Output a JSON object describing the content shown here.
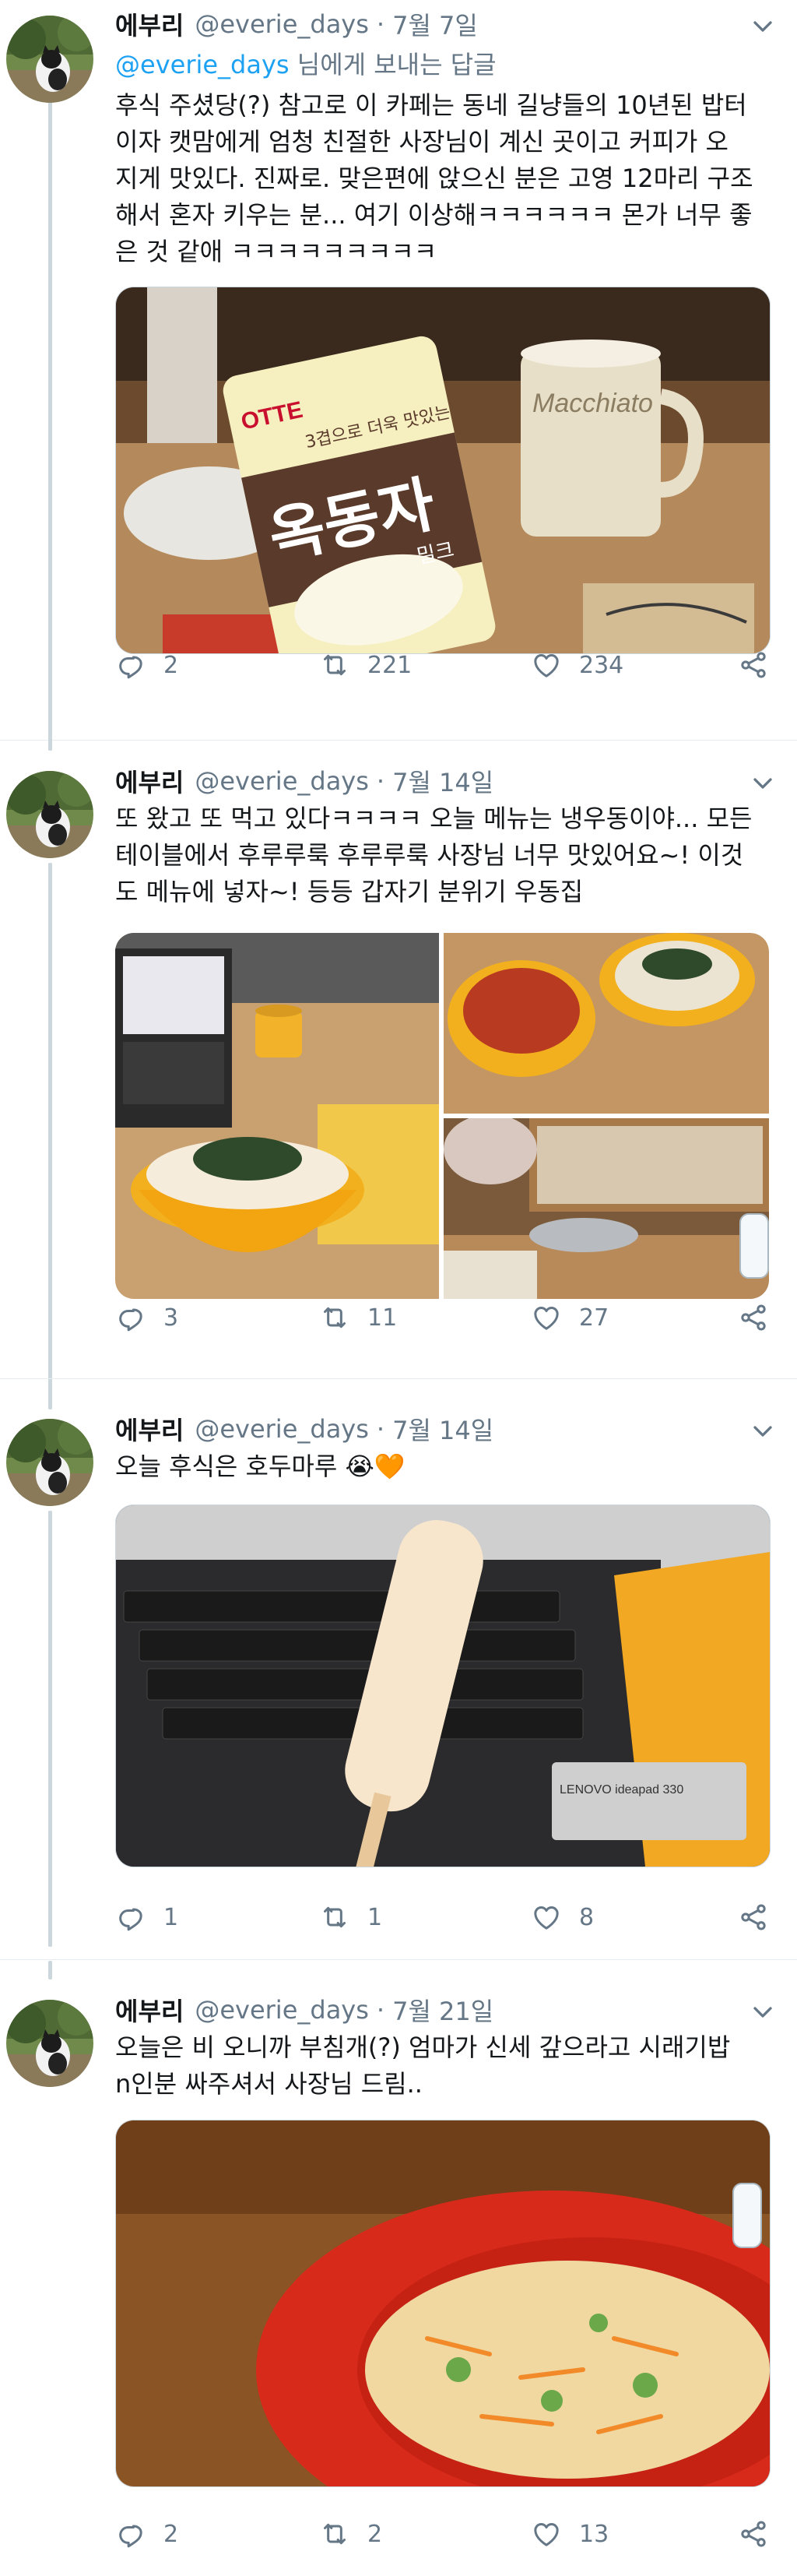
{
  "tweets": [
    {
      "name": "에부리",
      "handle": "@everie_days",
      "dot": "·",
      "date": "7월 7일",
      "reply_mention": "@everie_days",
      "reply_rest": " 님에게 보내는 답글",
      "lines": [
        "후식 주셨당(?) 참고로 이 카페는 동네 길냥들의 10년된 밥터",
        "이자 캣맘에게 엄청 친절한 사장님이 계신 곳이고 커피가 오",
        "지게 맛있다. 진짜로. 맞은편에 앉으신 분은 고영 12마리 구조",
        "해서 혼자 키우는 분... 여기 이상해ㅋㅋㅋㅋㅋㅋ 몬가 너무 좋",
        "은 것 같애 ㅋㅋㅋㅋㅋㅋㅋㅋㅋ"
      ],
      "photo_texts": {
        "brand": "OTTE",
        "slogan": "3겹으로 더욱 맛있는",
        "product": "옥동자",
        "flavor": "밀크",
        "mug": "Macchiato"
      },
      "replies": "2",
      "retweets": "221",
      "likes": "234"
    },
    {
      "name": "에부리",
      "handle": "@everie_days",
      "dot": "·",
      "date": "7월 14일",
      "lines": [
        "또 왔고 또 먹고 있다ㅋㅋㅋㅋ 오늘 메뉴는 냉우동이야... 모든",
        "테이블에서 후루루룩 후루루룩 사장님 너무 맛있어요~! 이것",
        "도 메뉴에 넣자~! 등등 갑자기 분위기 우동집"
      ],
      "replies": "3",
      "retweets": "11",
      "likes": "27"
    },
    {
      "name": "에부리",
      "handle": "@everie_days",
      "dot": "·",
      "date": "7월 14일",
      "lines": [
        "오늘 후식은 호두마루 😭🧡"
      ],
      "photo_texts": {
        "laptop": "LENOVO ideapad 330"
      },
      "replies": "1",
      "retweets": "1",
      "likes": "8"
    },
    {
      "name": "에부리",
      "handle": "@everie_days",
      "dot": "·",
      "date": "7월 21일",
      "lines": [
        "오늘은 비 오니까 부침개(?) 엄마가 신세 갚으라고 시래기밥",
        "n인분 싸주셔서 사장님 드림.."
      ],
      "replies": "2",
      "retweets": "2",
      "likes": "13"
    }
  ],
  "icons": {
    "reply": "reply-icon",
    "retweet": "retweet-icon",
    "like": "heart-icon",
    "share": "share-icon",
    "caret": "chevron-down-icon"
  },
  "colors": {
    "link": "#1da1f2",
    "secondary": "#657786",
    "thread": "#ccd6dd"
  }
}
